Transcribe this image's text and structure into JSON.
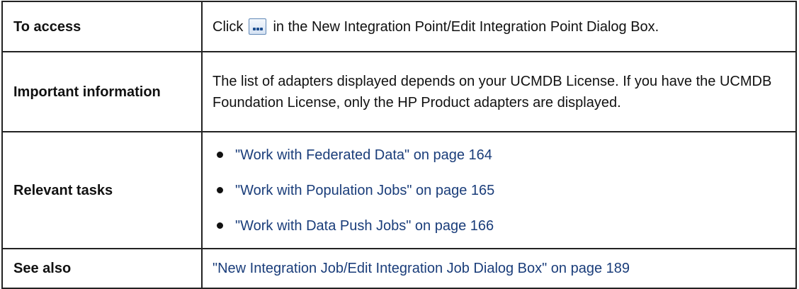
{
  "rows": [
    {
      "label": "To access",
      "text_before": "Click",
      "icon": "ellipsis-button-icon",
      "text_after": "in the New Integration Point/Edit Integration Point Dialog Box."
    },
    {
      "label": "Important information",
      "text": "The list of adapters displayed depends on your UCMDB License. If you have the UCMDB Foundation License, only the HP Product adapters are displayed."
    },
    {
      "label": "Relevant tasks",
      "tasks": [
        "\"Work with Federated Data\" on page 164",
        "\"Work with Population Jobs\" on page 165",
        "\"Work with Data Push Jobs\" on page 166"
      ]
    },
    {
      "label": "See also",
      "link": "\"New Integration Job/Edit Integration Job Dialog Box\" on page 189"
    }
  ],
  "colors": {
    "link": "#1a3d7a",
    "border": "#222222",
    "icon_border": "#5f87b6"
  }
}
